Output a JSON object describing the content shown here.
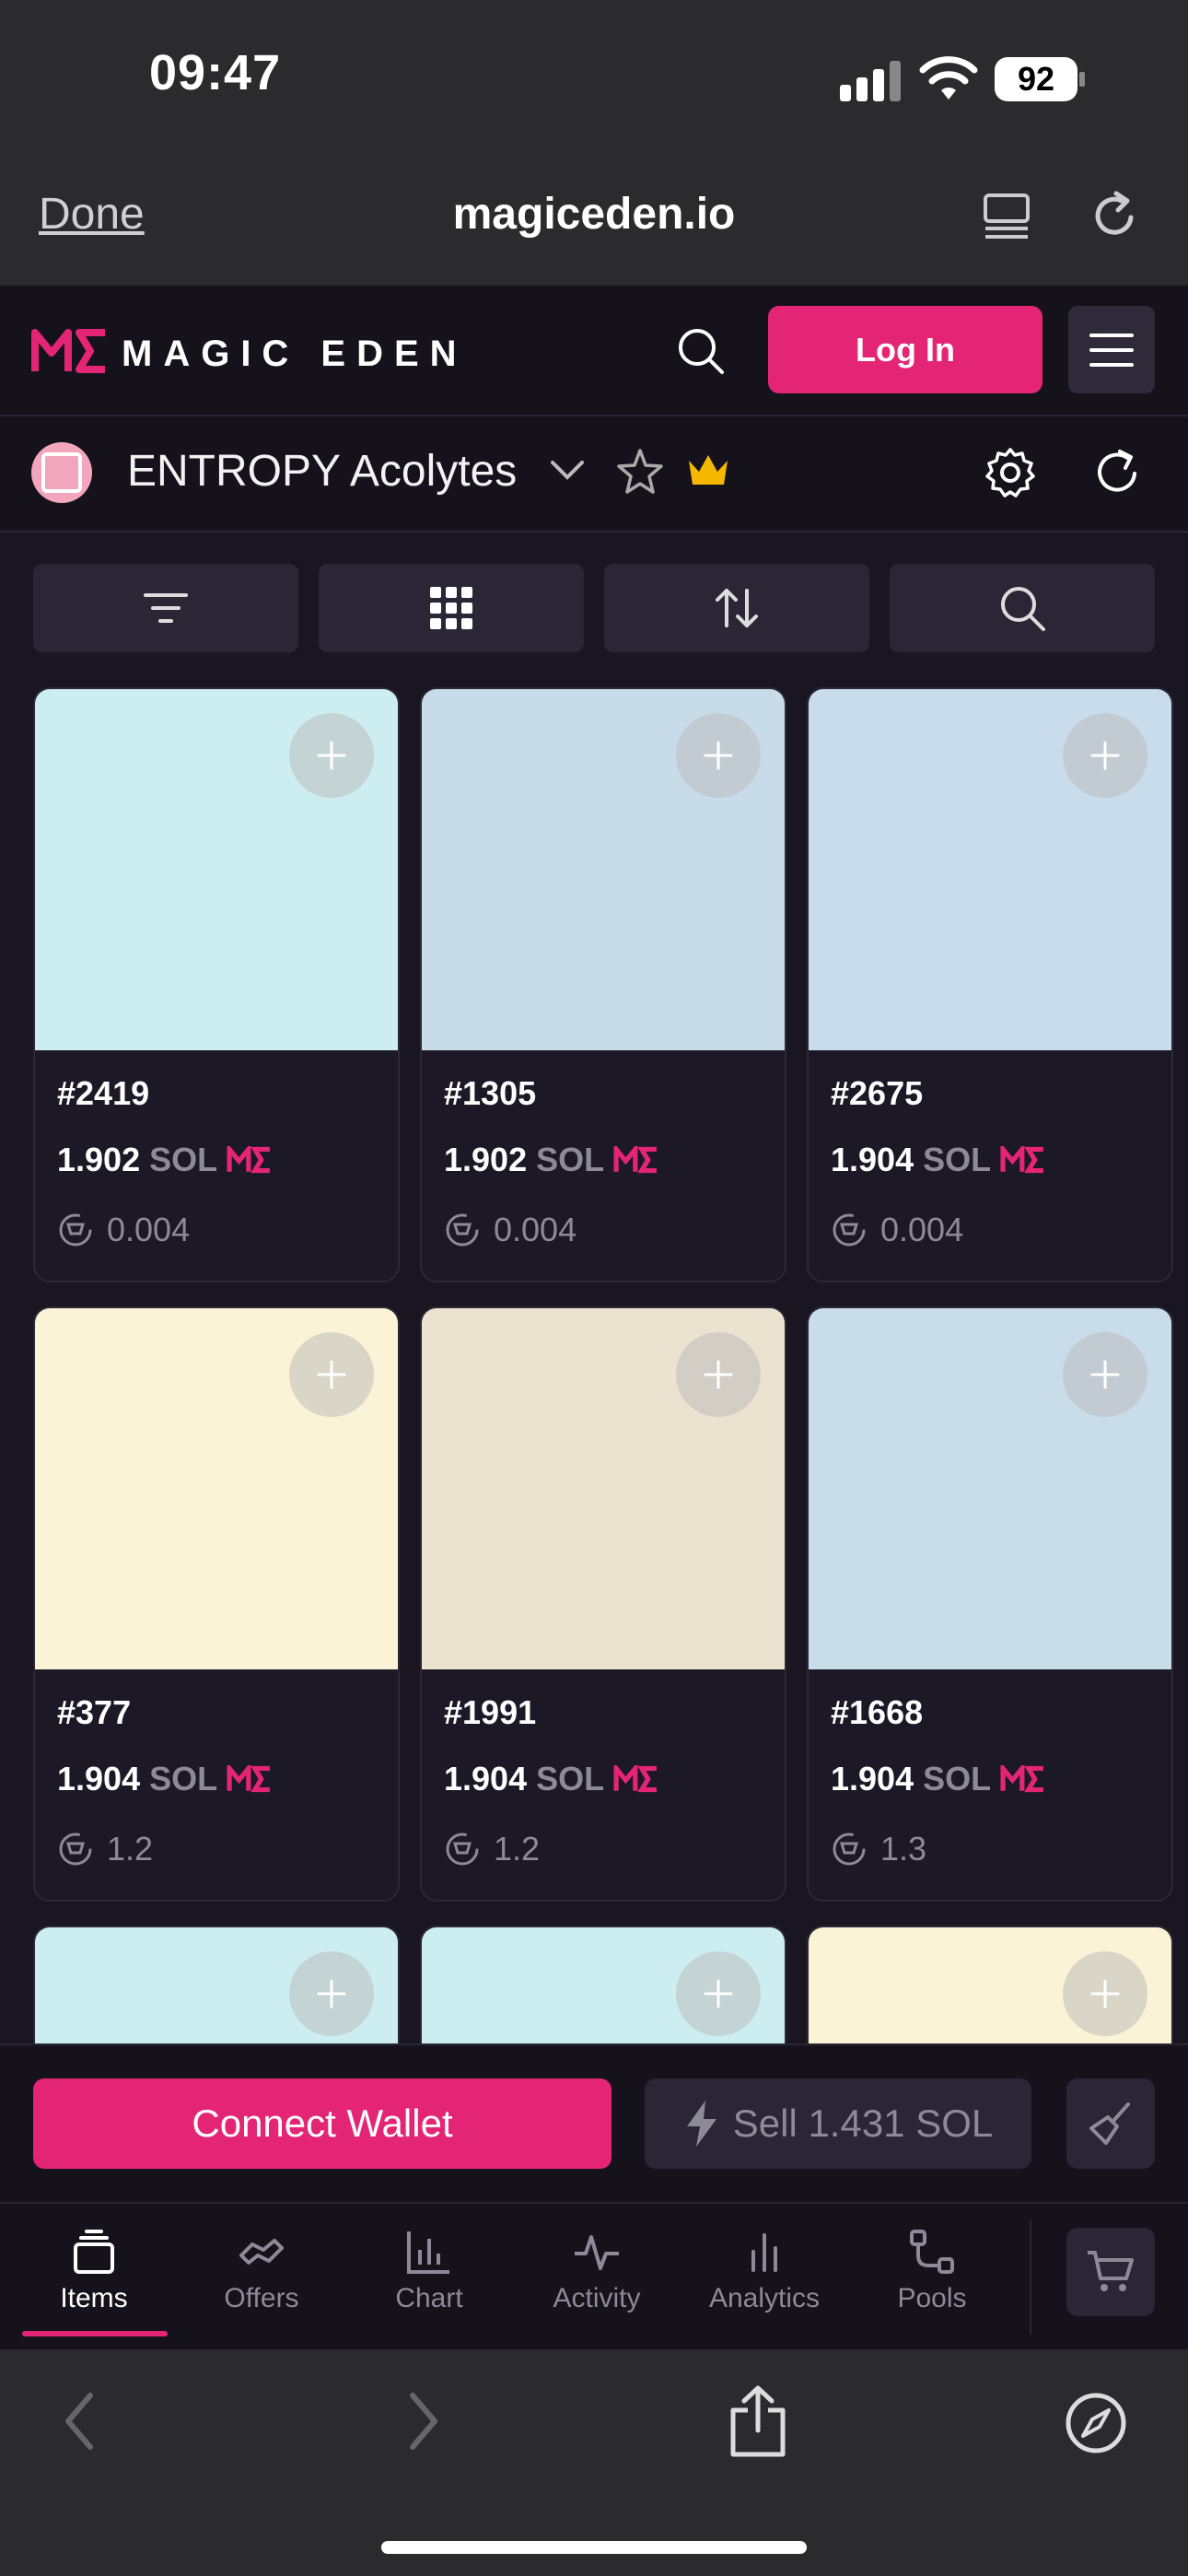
{
  "status_bar": {
    "time": "09:47",
    "battery": "92"
  },
  "safari": {
    "done_label": "Done",
    "url": "magiceden.io"
  },
  "header": {
    "brand": "MAGIC EDEN",
    "login_label": "Log In"
  },
  "collection": {
    "name": "ENTROPY Acolytes"
  },
  "items": [
    {
      "id": "#2419",
      "price": "1.902",
      "currency": "SOL",
      "fee": "0.004",
      "bg": "#cdeef0"
    },
    {
      "id": "#1305",
      "price": "1.902",
      "currency": "SOL",
      "fee": "0.004",
      "bg": "#c7dce8"
    },
    {
      "id": "#2675",
      "price": "1.904",
      "currency": "SOL",
      "fee": "0.004",
      "bg": "#c9dcec"
    },
    {
      "id": "#377",
      "price": "1.904",
      "currency": "SOL",
      "fee": "1.2",
      "bg": "#faf3d6"
    },
    {
      "id": "#1991",
      "price": "1.904",
      "currency": "SOL",
      "fee": "1.2",
      "bg": "#ece2d0"
    },
    {
      "id": "#1668",
      "price": "1.904",
      "currency": "SOL",
      "fee": "1.3",
      "bg": "#c8dcea"
    }
  ],
  "partial_items": [
    {
      "bg": "#cdeef0"
    },
    {
      "bg": "#cdeef0"
    },
    {
      "bg": "#faf3d6"
    }
  ],
  "actions": {
    "connect_label": "Connect Wallet",
    "sell_label": "Sell 1.431 SOL"
  },
  "tabs": [
    {
      "label": "Items",
      "icon": "stack-icon",
      "active": true
    },
    {
      "label": "Offers",
      "icon": "handshake-icon"
    },
    {
      "label": "Chart",
      "icon": "bar-chart-icon"
    },
    {
      "label": "Activity",
      "icon": "pulse-icon"
    },
    {
      "label": "Analytics",
      "icon": "analytics-icon"
    },
    {
      "label": "Pools",
      "icon": "pools-icon"
    }
  ],
  "colors": {
    "accent": "#e42575",
    "bg": "#15121c",
    "card": "#1c1826",
    "muted": "#8d8a97",
    "crown": "#f5b800"
  }
}
